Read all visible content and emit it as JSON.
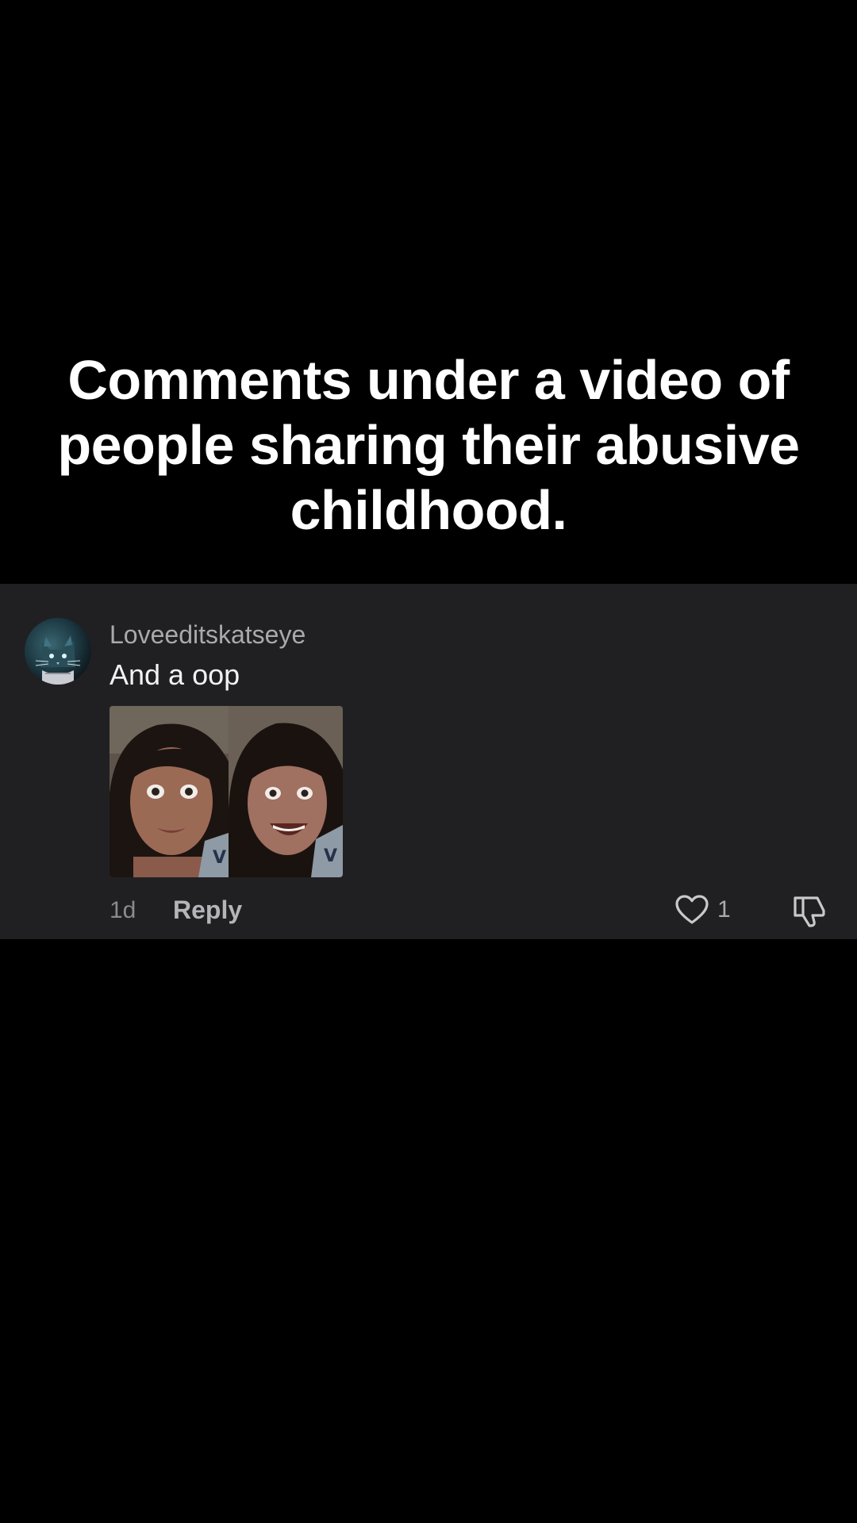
{
  "caption": {
    "line1": "Comments under a video of",
    "line2": "people sharing their abusive",
    "line3": "childhood."
  },
  "comment": {
    "username": "Loveeditskatseye",
    "text": "And a oop",
    "timestamp": "1d",
    "reply_label": "Reply",
    "like_count": "1",
    "icons": {
      "avatar": "cat-avatar",
      "like": "heart-icon",
      "dislike": "thumbs-down-icon"
    }
  },
  "colors": {
    "background": "#000000",
    "card": "#202022",
    "text_primary": "#f2f2f2",
    "text_secondary": "#a9a9ae"
  }
}
